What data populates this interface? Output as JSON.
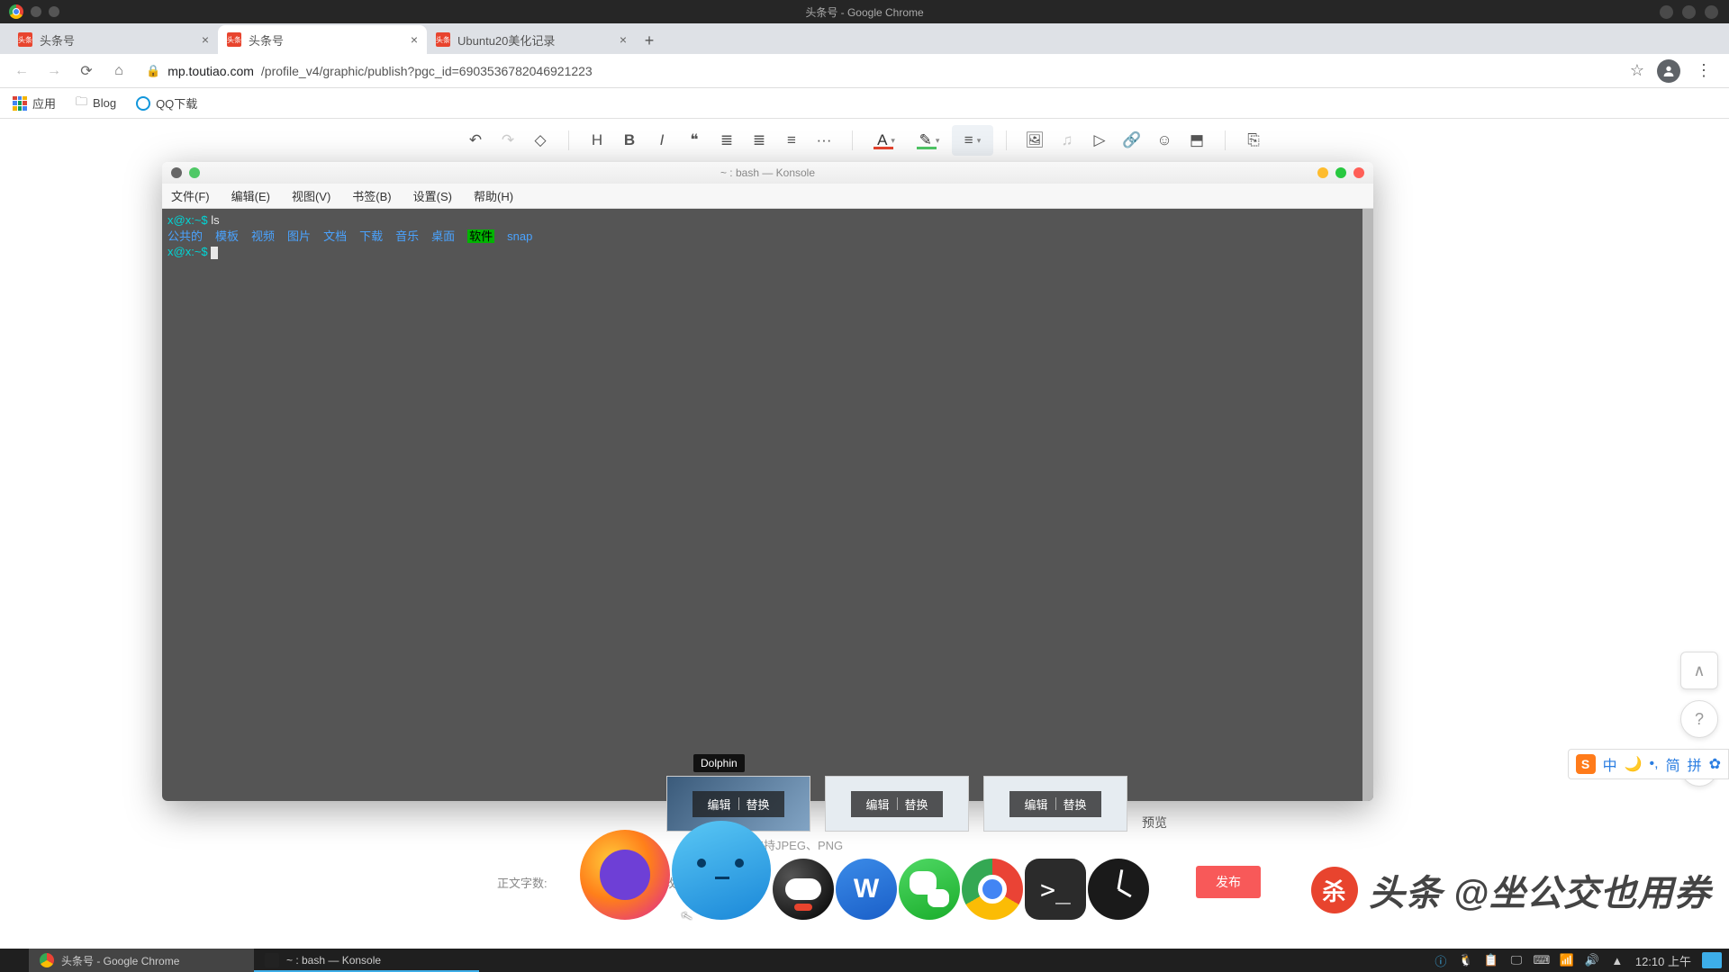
{
  "window_title": "头条号 - Google Chrome",
  "tabs": [
    {
      "favicon": "头条",
      "title": "头条号",
      "active": false
    },
    {
      "favicon": "头条",
      "title": "头条号",
      "active": true
    },
    {
      "favicon": "头条",
      "title": "Ubuntu20美化记录",
      "active": false
    }
  ],
  "url": {
    "domain": "mp.toutiao.com",
    "path": "/profile_v4/graphic/publish?pgc_id=6903536782046921223"
  },
  "bookmarks": {
    "apps": "应用",
    "items": [
      "Blog",
      "QQ下载"
    ]
  },
  "editor_toolbar": {
    "undo": "↶",
    "redo": "↷",
    "clear": "◇",
    "h": "H",
    "bold": "B",
    "italic": "I",
    "quote": "❝",
    "ul": "≣",
    "ol": "≣",
    "align_btn": "≡",
    "more": "···",
    "textcolor": "A",
    "hilite": "✎",
    "align": "≡",
    "image": "🖼",
    "music": "♫",
    "video": "▷",
    "link": "🔗",
    "emoji": "☺",
    "vote": "⬒",
    "paging": "⎘"
  },
  "konsole": {
    "title": "~ : bash — Konsole",
    "menus": [
      "文件(F)",
      "编辑(E)",
      "视图(V)",
      "书签(B)",
      "设置(S)",
      "帮助(H)"
    ],
    "prompt_user": "x@x",
    "prompt_path": ":~$",
    "cmd": "ls",
    "dirs": [
      "公共的",
      "模板",
      "视频",
      "图片",
      "文档",
      "下载",
      "音乐",
      "桌面"
    ],
    "exec": "软件",
    "snap": "snap"
  },
  "thumbs": {
    "tooltip": "Dolphin",
    "edit": "编辑",
    "replace": "替换",
    "preview": "预览"
  },
  "hint_text": "推荐，格式支持JPEG、PNG",
  "status": {
    "words_label": "正文字数:",
    "save_label": "改次数",
    "publish": "发布"
  },
  "dock": {
    "wps": "W",
    "term": ">_"
  },
  "watermark": {
    "brand": "杀",
    "text": "头条 @坐公交也用券"
  },
  "ime": {
    "chars": [
      "中",
      "🌙",
      "•,",
      "简",
      "拼",
      "✿"
    ]
  },
  "taskbar": {
    "tasks": [
      {
        "label": "头条号 - Google Chrome",
        "icon": "chrome",
        "active": true
      },
      {
        "label": "~ : bash — Konsole",
        "icon": "term",
        "active": false,
        "hl": true
      }
    ],
    "time": "12:10 上午"
  }
}
